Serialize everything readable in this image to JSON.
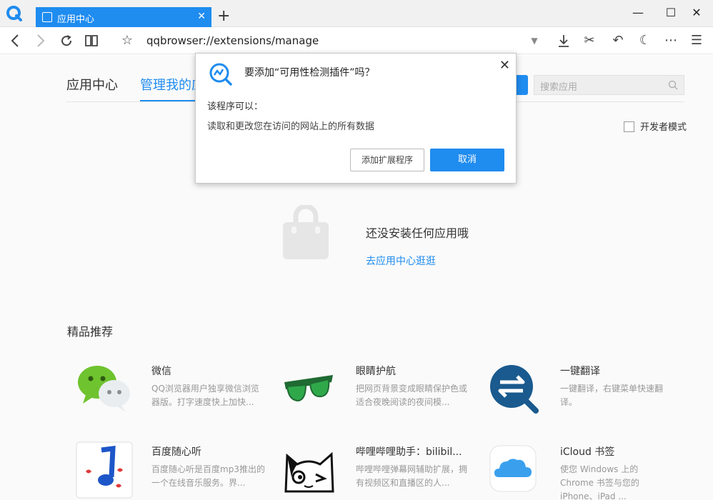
{
  "browser": {
    "tab_title": "应用中心",
    "new_tab_symbol": "+",
    "url": "qqbrowser://extensions/manage"
  },
  "page": {
    "nav": {
      "tab_app_center": "应用中心",
      "tab_manage": "管理我的应用"
    },
    "search_placeholder": "搜索应用",
    "developer_mode_label": "开发者模式",
    "empty_title": "还没安装任何应用哦",
    "empty_link": "去应用中心逛逛",
    "recommended_title": "精品推荐",
    "apps": [
      {
        "name": "微信",
        "desc": "QQ浏览器用户独享微信浏览器版。打字速度快上加快..."
      },
      {
        "name": "眼睛护航",
        "desc": "把网页背景变成眼睛保护色或适合夜晚阅读的夜间模..."
      },
      {
        "name": "一键翻译",
        "desc": "一键翻译，右键菜单快速翻译。"
      },
      {
        "name": "百度随心听",
        "desc": "百度随心听是百度mp3推出的一个在线音乐服务。界..."
      },
      {
        "name": "哔哩哔哩助手：bilibil...",
        "desc": "哔哩哔哩弹幕网辅助扩展，拥有视频区和直播区的人..."
      },
      {
        "name": "iCloud 书签",
        "desc": "使您 Windows 上的 Chrome 书签与您的 iPhone、iPad ..."
      }
    ]
  },
  "dialog": {
    "title": "要添加“可用性检测插件”吗？",
    "can_label": "该程序可以：",
    "permission": "读取和更改您在访问的网站上的所有数据",
    "add_button": "添加扩展程序",
    "cancel_button": "取消"
  }
}
